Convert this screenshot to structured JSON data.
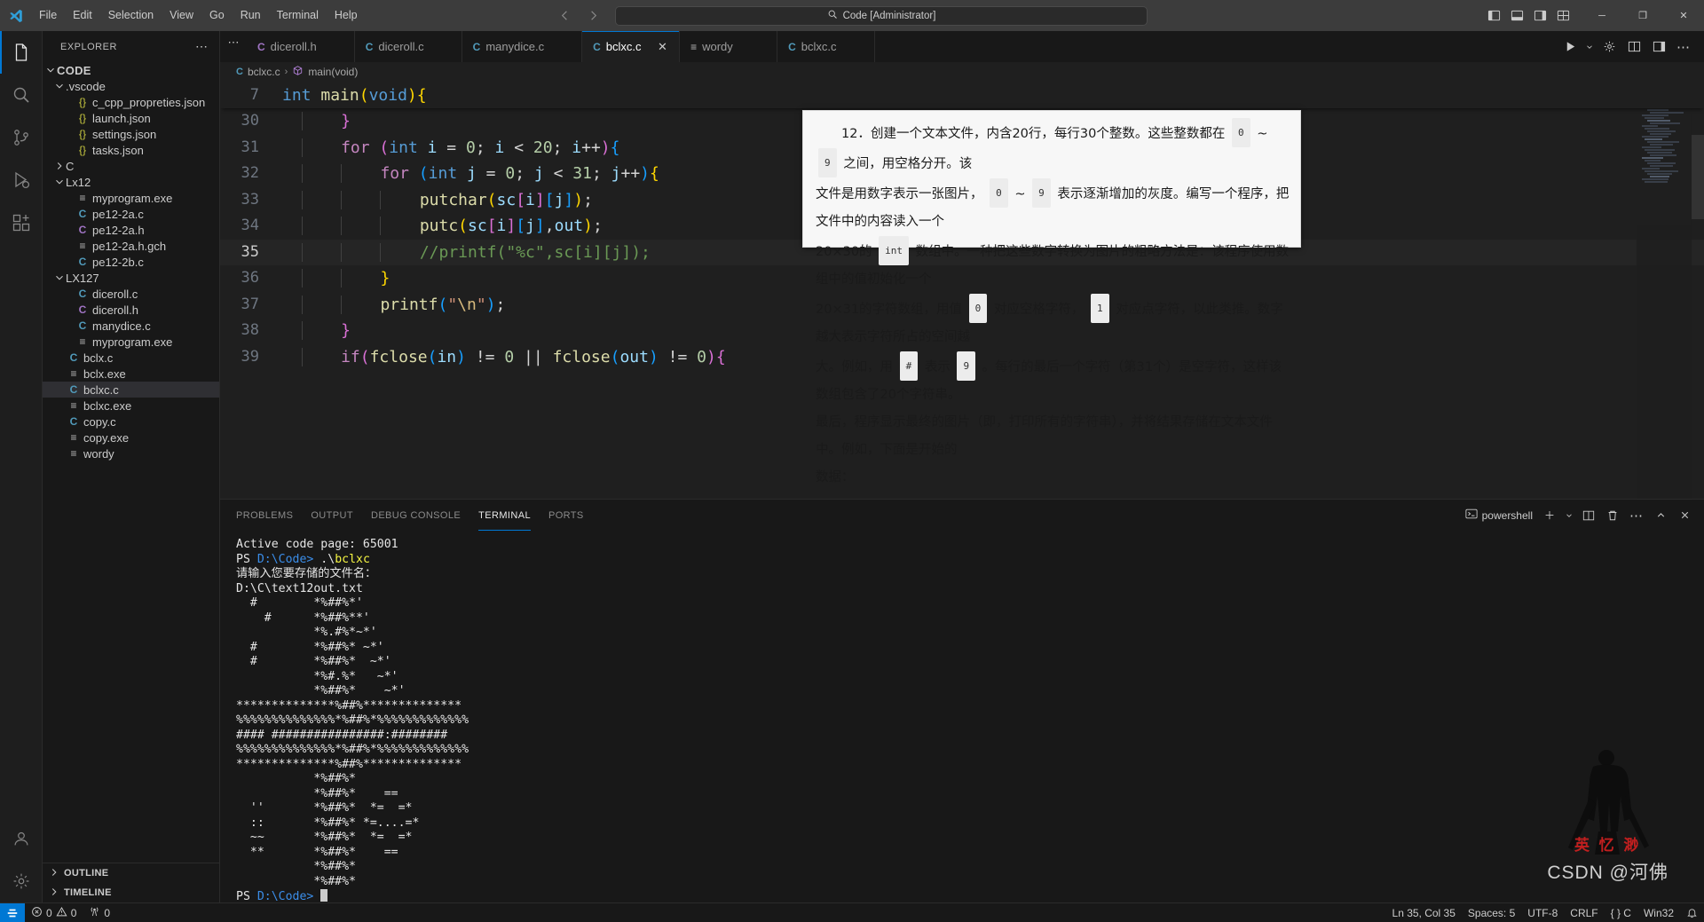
{
  "titlebar": {
    "menu": [
      "File",
      "Edit",
      "Selection",
      "View",
      "Go",
      "Run",
      "Terminal",
      "Help"
    ],
    "command_center": "Code [Administrator]",
    "back_icon": "arrow-left-icon",
    "forward_icon": "arrow-right-icon",
    "window_minimize": "─",
    "window_maximize": "❐",
    "window_close": "✕"
  },
  "activitybar": {
    "items": [
      {
        "name": "explorer",
        "icon": "files-icon",
        "active": true
      },
      {
        "name": "search",
        "icon": "search-icon",
        "active": false
      },
      {
        "name": "source-control",
        "icon": "source-control-icon",
        "active": false
      },
      {
        "name": "run-debug",
        "icon": "run-debug-icon",
        "active": false
      },
      {
        "name": "extensions",
        "icon": "extensions-icon",
        "active": false
      }
    ],
    "bottom": [
      {
        "name": "accounts",
        "icon": "account-icon"
      },
      {
        "name": "settings",
        "icon": "gear-icon"
      }
    ]
  },
  "sidebar": {
    "title": "EXPLORER",
    "more_actions": "⋯",
    "tree": [
      {
        "label": "CODE",
        "kind": "root",
        "depth": 0,
        "chev": "down",
        "icon": ""
      },
      {
        "label": ".vscode",
        "kind": "folder",
        "depth": 1,
        "chev": "down",
        "icon": ""
      },
      {
        "label": "c_cpp_propreties.json",
        "kind": "json",
        "depth": 2,
        "chev": "",
        "icon": "{}"
      },
      {
        "label": "launch.json",
        "kind": "json",
        "depth": 2,
        "chev": "",
        "icon": "{}"
      },
      {
        "label": "settings.json",
        "kind": "json",
        "depth": 2,
        "chev": "",
        "icon": "{}"
      },
      {
        "label": "tasks.json",
        "kind": "json",
        "depth": 2,
        "chev": "",
        "icon": "{}"
      },
      {
        "label": "C",
        "kind": "folder",
        "depth": 1,
        "chev": "right",
        "icon": ""
      },
      {
        "label": "Lx12",
        "kind": "folder",
        "depth": 1,
        "chev": "down",
        "icon": ""
      },
      {
        "label": "myprogram.exe",
        "kind": "exe",
        "depth": 2,
        "chev": "",
        "icon": "≡"
      },
      {
        "label": "pe12-2a.c",
        "kind": "c",
        "depth": 2,
        "chev": "",
        "icon": "C"
      },
      {
        "label": "pe12-2a.h",
        "kind": "h",
        "depth": 2,
        "chev": "",
        "icon": "C"
      },
      {
        "label": "pe12-2a.h.gch",
        "kind": "exe",
        "depth": 2,
        "chev": "",
        "icon": "≡"
      },
      {
        "label": "pe12-2b.c",
        "kind": "c",
        "depth": 2,
        "chev": "",
        "icon": "C"
      },
      {
        "label": "LX127",
        "kind": "folder",
        "depth": 1,
        "chev": "down",
        "icon": ""
      },
      {
        "label": "diceroll.c",
        "kind": "c",
        "depth": 2,
        "chev": "",
        "icon": "C"
      },
      {
        "label": "diceroll.h",
        "kind": "h",
        "depth": 2,
        "chev": "",
        "icon": "C"
      },
      {
        "label": "manydice.c",
        "kind": "c",
        "depth": 2,
        "chev": "",
        "icon": "C"
      },
      {
        "label": "myprogram.exe",
        "kind": "exe",
        "depth": 2,
        "chev": "",
        "icon": "≡"
      },
      {
        "label": "bclx.c",
        "kind": "c",
        "depth": 1,
        "chev": "",
        "icon": "C"
      },
      {
        "label": "bclx.exe",
        "kind": "exe",
        "depth": 1,
        "chev": "",
        "icon": "≡"
      },
      {
        "label": "bclxc.c",
        "kind": "c",
        "depth": 1,
        "chev": "",
        "icon": "C",
        "selected": true
      },
      {
        "label": "bclxc.exe",
        "kind": "exe",
        "depth": 1,
        "chev": "",
        "icon": "≡"
      },
      {
        "label": "copy.c",
        "kind": "c",
        "depth": 1,
        "chev": "",
        "icon": "C"
      },
      {
        "label": "copy.exe",
        "kind": "exe",
        "depth": 1,
        "chev": "",
        "icon": "≡"
      },
      {
        "label": "wordy",
        "kind": "exe",
        "depth": 1,
        "chev": "",
        "icon": "≡"
      }
    ],
    "sections": [
      {
        "label": "OUTLINE",
        "chev": "right"
      },
      {
        "label": "TIMELINE",
        "chev": "right"
      }
    ]
  },
  "editor": {
    "tabs": [
      {
        "label": "diceroll.h",
        "icon": "C",
        "kind": "h",
        "active": false
      },
      {
        "label": "diceroll.c",
        "icon": "C",
        "kind": "c",
        "active": false
      },
      {
        "label": "manydice.c",
        "icon": "C",
        "kind": "c",
        "active": false
      },
      {
        "label": "bclxc.c",
        "icon": "C",
        "kind": "c",
        "active": true
      },
      {
        "label": "wordy",
        "icon": "≡",
        "kind": "exe",
        "active": false
      },
      {
        "label": "bclxc.c",
        "icon": "C",
        "kind": "c",
        "active": false
      }
    ],
    "tab_close": "✕",
    "more_tabs": "⋯",
    "actions": [
      "run-icon",
      "chevron-down-icon",
      "settings-gear-icon",
      "split-editor-icon",
      "layout-icon",
      "more-actions-icon"
    ],
    "breadcrumb": {
      "file_icon": "C",
      "file": "bclxc.c",
      "separator": "›",
      "symbol_icon": "symbol-method-icon",
      "symbol": "main(void)"
    },
    "sticky": {
      "num": "7",
      "text": "int main(void){"
    },
    "lines": [
      {
        "num": "30",
        "indent": 3,
        "tokens": [
          {
            "t": "}",
            "c": "p2"
          }
        ]
      },
      {
        "num": "31",
        "indent": 3,
        "tokens": [
          {
            "t": "for ",
            "c": "k"
          },
          {
            "t": "(",
            "c": "p2"
          },
          {
            "t": "int",
            "c": "kw"
          },
          {
            "t": " i ",
            "c": "var"
          },
          {
            "t": "= ",
            "c": "op"
          },
          {
            "t": "0",
            "c": "num"
          },
          {
            "t": "; ",
            "c": "op"
          },
          {
            "t": "i ",
            "c": "var"
          },
          {
            "t": "< ",
            "c": "op"
          },
          {
            "t": "20",
            "c": "num"
          },
          {
            "t": "; ",
            "c": "op"
          },
          {
            "t": "i",
            "c": "var"
          },
          {
            "t": "++",
            "c": "op"
          },
          {
            "t": ")",
            "c": "p2"
          },
          {
            "t": "{",
            "c": "p3"
          }
        ]
      },
      {
        "num": "32",
        "indent": 5,
        "tokens": [
          {
            "t": "for ",
            "c": "k"
          },
          {
            "t": "(",
            "c": "p3"
          },
          {
            "t": "int",
            "c": "kw"
          },
          {
            "t": " j ",
            "c": "var"
          },
          {
            "t": "= ",
            "c": "op"
          },
          {
            "t": "0",
            "c": "num"
          },
          {
            "t": "; ",
            "c": "op"
          },
          {
            "t": "j ",
            "c": "var"
          },
          {
            "t": "< ",
            "c": "op"
          },
          {
            "t": "31",
            "c": "num"
          },
          {
            "t": "; ",
            "c": "op"
          },
          {
            "t": "j",
            "c": "var"
          },
          {
            "t": "++",
            "c": "op"
          },
          {
            "t": ")",
            "c": "p3"
          },
          {
            "t": "{",
            "c": "p1"
          }
        ]
      },
      {
        "num": "33",
        "indent": 7,
        "tokens": [
          {
            "t": "putchar",
            "c": "fn"
          },
          {
            "t": "(",
            "c": "p1"
          },
          {
            "t": "sc",
            "c": "var"
          },
          {
            "t": "[",
            "c": "p2"
          },
          {
            "t": "i",
            "c": "var"
          },
          {
            "t": "]",
            "c": "p2"
          },
          {
            "t": "[",
            "c": "p3"
          },
          {
            "t": "j",
            "c": "var"
          },
          {
            "t": "]",
            "c": "p3"
          },
          {
            "t": ")",
            "c": "p1"
          },
          {
            "t": ";",
            "c": "op"
          }
        ]
      },
      {
        "num": "34",
        "indent": 7,
        "tokens": [
          {
            "t": "putc",
            "c": "fn"
          },
          {
            "t": "(",
            "c": "p1"
          },
          {
            "t": "sc",
            "c": "var"
          },
          {
            "t": "[",
            "c": "p2"
          },
          {
            "t": "i",
            "c": "var"
          },
          {
            "t": "]",
            "c": "p2"
          },
          {
            "t": "[",
            "c": "p3"
          },
          {
            "t": "j",
            "c": "var"
          },
          {
            "t": "]",
            "c": "p3"
          },
          {
            "t": ",",
            "c": "op"
          },
          {
            "t": "out",
            "c": "var"
          },
          {
            "t": ")",
            "c": "p1"
          },
          {
            "t": ";",
            "c": "op"
          }
        ]
      },
      {
        "num": "35",
        "indent": 7,
        "current": true,
        "tokens": [
          {
            "t": "//printf(\"%c\",sc[i][j]);",
            "c": "cmt"
          }
        ]
      },
      {
        "num": "36",
        "indent": 5,
        "tokens": [
          {
            "t": "}",
            "c": "p1"
          }
        ]
      },
      {
        "num": "37",
        "indent": 5,
        "tokens": [
          {
            "t": "printf",
            "c": "fn"
          },
          {
            "t": "(",
            "c": "p3"
          },
          {
            "t": "\"",
            "c": "str"
          },
          {
            "t": "\\n",
            "c": "esc"
          },
          {
            "t": "\"",
            "c": "str"
          },
          {
            "t": ")",
            "c": "p3"
          },
          {
            "t": ";",
            "c": "op"
          }
        ]
      },
      {
        "num": "38",
        "indent": 3,
        "tokens": [
          {
            "t": "}",
            "c": "p2"
          }
        ]
      },
      {
        "num": "39",
        "indent": 3,
        "tokens": [
          {
            "t": "if",
            "c": "k"
          },
          {
            "t": "(",
            "c": "p2"
          },
          {
            "t": "fclose",
            "c": "fn"
          },
          {
            "t": "(",
            "c": "p3"
          },
          {
            "t": "in",
            "c": "var"
          },
          {
            "t": ")",
            "c": "p3"
          },
          {
            "t": " != ",
            "c": "op"
          },
          {
            "t": "0",
            "c": "num"
          },
          {
            "t": " || ",
            "c": "op"
          },
          {
            "t": "fclose",
            "c": "fn"
          },
          {
            "t": "(",
            "c": "p3"
          },
          {
            "t": "out",
            "c": "var"
          },
          {
            "t": ")",
            "c": "p3"
          },
          {
            "t": " != ",
            "c": "op"
          },
          {
            "t": "0",
            "c": "num"
          },
          {
            "t": "){",
            "c": "p2"
          }
        ]
      }
    ]
  },
  "overlay": {
    "lines": [
      "　　12．创建一个文本文件，内含20行，每行30个整数。这些整数都在 0 ~ 9 之间，用空格分开。该",
      "文件是用数字表示一张图片， 0 ~ 9 表示逐渐增加的灰度。编写一个程序，把文件中的内容读入一个",
      "20×30的 int 数组中。一种把这些数字转换为图片的粗略方法是：该程序使用数组中的值初始化一个",
      "20×31的字符数组，用值 0 对应空格字符， 1 对应点字符，以此类推。数字越大表示字符所占的空间越",
      "大。例如，用 # 表示 9 。每行的最后一个字符（第31个）是空字符，这样该数组包含了20个字符串。",
      "最后，程序显示最终的图片（即，打印所有的字符串），并将结果存储在文本文件中。例如，下面是开始的",
      "数据："
    ]
  },
  "panel": {
    "tabs": [
      "PROBLEMS",
      "OUTPUT",
      "DEBUG CONSOLE",
      "TERMINAL",
      "PORTS"
    ],
    "active_tab": "TERMINAL",
    "shell_label": "powershell",
    "shell_icon": "terminal-powershell-icon",
    "actions": [
      "add-terminal-icon",
      "chevron-down-icon",
      "split-terminal-icon",
      "kill-terminal-icon",
      "more-actions-icon",
      "maximize-panel-icon",
      "close-panel-icon"
    ],
    "terminal_lines": [
      {
        "segs": [
          {
            "t": "Active code page: 65001",
            "c": "t-white"
          }
        ]
      },
      {
        "segs": [
          {
            "t": "PS ",
            "c": "t-white"
          },
          {
            "t": "D:\\Code>",
            "c": "t-blue"
          },
          {
            "t": " .\\",
            "c": "t-white"
          },
          {
            "t": "bclxc",
            "c": "t-yellow"
          }
        ]
      },
      {
        "segs": [
          {
            "t": "请输入您要存储的文件名：",
            "c": "t-white"
          }
        ]
      },
      {
        "segs": [
          {
            "t": "D:\\C\\text12out.txt",
            "c": "t-white"
          }
        ]
      },
      {
        "segs": [
          {
            "t": "  #        *%##%*'",
            "c": "t-white"
          }
        ]
      },
      {
        "segs": [
          {
            "t": "    #      *%##%**'",
            "c": "t-white"
          }
        ]
      },
      {
        "segs": [
          {
            "t": "           *%.#%*~*'",
            "c": "t-white"
          }
        ]
      },
      {
        "segs": [
          {
            "t": "  #        *%##%* ~*'",
            "c": "t-white"
          }
        ]
      },
      {
        "segs": [
          {
            "t": "  #        *%##%*  ~*'",
            "c": "t-white"
          }
        ]
      },
      {
        "segs": [
          {
            "t": "           *%#.%*   ~*'",
            "c": "t-white"
          }
        ]
      },
      {
        "segs": [
          {
            "t": "           *%##%*    ~*'",
            "c": "t-white"
          }
        ]
      },
      {
        "segs": [
          {
            "t": "**************%##%**************",
            "c": "t-white"
          }
        ]
      },
      {
        "segs": [
          {
            "t": "%%%%%%%%%%%%%%*%##%*%%%%%%%%%%%%%",
            "c": "t-white"
          }
        ]
      },
      {
        "segs": [
          {
            "t": "#### ################:########",
            "c": "t-white"
          }
        ]
      },
      {
        "segs": [
          {
            "t": "%%%%%%%%%%%%%%*%##%*%%%%%%%%%%%%%",
            "c": "t-white"
          }
        ]
      },
      {
        "segs": [
          {
            "t": "**************%##%**************",
            "c": "t-white"
          }
        ]
      },
      {
        "segs": [
          {
            "t": "           *%##%*",
            "c": "t-white"
          }
        ]
      },
      {
        "segs": [
          {
            "t": "           *%##%*    ==",
            "c": "t-white"
          }
        ]
      },
      {
        "segs": [
          {
            "t": "  ''       *%##%*  *=  =*",
            "c": "t-white"
          }
        ]
      },
      {
        "segs": [
          {
            "t": "  ::       *%##%* *=....=*",
            "c": "t-white"
          }
        ]
      },
      {
        "segs": [
          {
            "t": "  ~~       *%##%*  *=  =*",
            "c": "t-white"
          }
        ]
      },
      {
        "segs": [
          {
            "t": "  **       *%##%*    ==",
            "c": "t-white"
          }
        ]
      },
      {
        "segs": [
          {
            "t": "           *%##%*",
            "c": "t-white"
          }
        ]
      },
      {
        "segs": [
          {
            "t": "           *%##%*",
            "c": "t-white"
          }
        ]
      },
      {
        "segs": [
          {
            "t": "PS ",
            "c": "t-white"
          },
          {
            "t": "D:\\Code>",
            "c": "t-blue"
          },
          {
            "t": " ",
            "c": "t-white"
          }
        ],
        "cursor": true
      }
    ]
  },
  "watermark": {
    "brand": "CSDN @河佛",
    "emblem_text": "英 忆 渺"
  },
  "statusbar": {
    "remote_icon": "remote-indicator-icon",
    "left": [
      {
        "name": "problems",
        "icon": "error-warning-icon",
        "text": "0  0"
      },
      {
        "name": "ports",
        "icon": "radio-tower-icon",
        "text": "0"
      }
    ],
    "right": [
      {
        "name": "cursor-position",
        "text": "Ln 35, Col 35"
      },
      {
        "name": "indentation",
        "text": "Spaces: 5"
      },
      {
        "name": "encoding",
        "text": "UTF-8"
      },
      {
        "name": "eol",
        "text": "CRLF"
      },
      {
        "name": "language-mode",
        "text": "{ }  C"
      },
      {
        "name": "win32",
        "text": "Win32"
      }
    ]
  },
  "colors": {
    "accent": "#0078d4",
    "titlebar_bg": "#3c3c3c",
    "sidebar_bg": "#181818",
    "editor_bg": "#1f1f1f"
  }
}
